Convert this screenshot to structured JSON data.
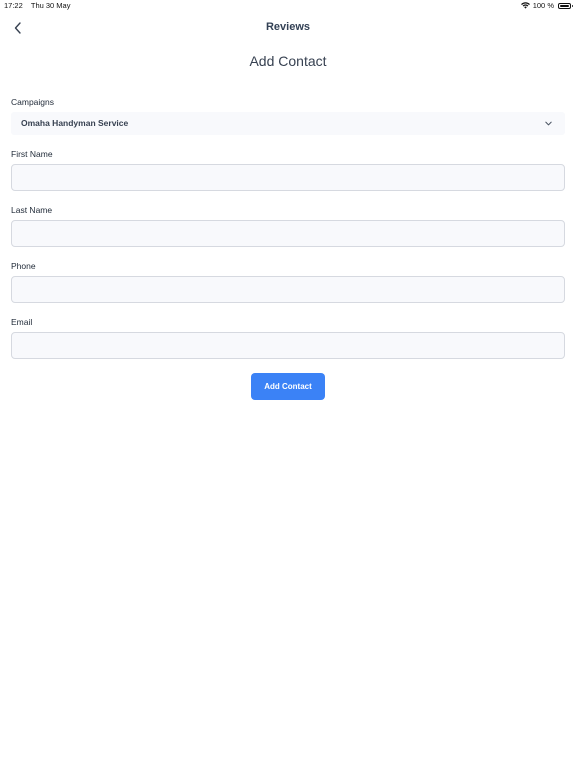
{
  "status_bar": {
    "time": "17:22",
    "date": "Thu 30 May",
    "battery_text": "100 %",
    "icons": [
      "wifi-icon",
      "battery-icon"
    ]
  },
  "nav": {
    "title": "Reviews",
    "back_icon": "chevron-left-icon"
  },
  "page": {
    "heading": "Add Contact"
  },
  "form": {
    "campaign_label": "Campaigns",
    "campaign_selected": "Omaha Handyman Service",
    "campaign_icon": "chevron-down-icon",
    "first_name_label": "First Name",
    "first_name_value": "",
    "last_name_label": "Last Name",
    "last_name_value": "",
    "phone_label": "Phone",
    "phone_value": "",
    "email_label": "Email",
    "email_value": "",
    "submit_label": "Add Contact"
  },
  "colors": {
    "accent": "#3b82f6",
    "input_background": "#f8f9fc",
    "input_border": "#d6d9e0"
  }
}
